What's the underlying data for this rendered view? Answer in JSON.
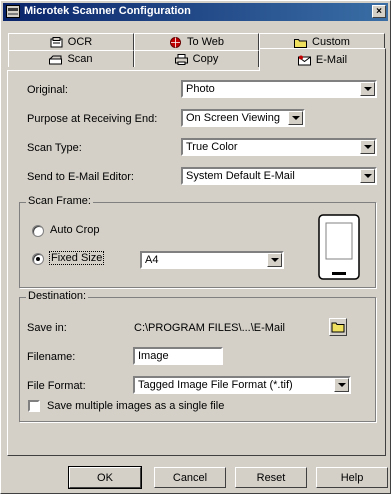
{
  "window": {
    "title": "Microtek Scanner Configuration",
    "close_glyph": "×"
  },
  "tabs": {
    "ocr": {
      "label": "OCR",
      "icon": "ocr-icon"
    },
    "to_web": {
      "label": "To Web",
      "icon": "web-globe-icon"
    },
    "custom": {
      "label": "Custom",
      "icon": "folder-icon"
    },
    "scan": {
      "label": "Scan",
      "icon": "scanner-icon"
    },
    "copy": {
      "label": "Copy",
      "icon": "printer-icon"
    },
    "email": {
      "label": "E-Mail",
      "icon": "email-icon",
      "active": true
    }
  },
  "form": {
    "original": {
      "label": "Original:",
      "value": "Photo"
    },
    "purpose": {
      "label": "Purpose at Receiving End:",
      "value": "On Screen Viewing"
    },
    "scan_type": {
      "label": "Scan Type:",
      "value": "True Color"
    },
    "send_to": {
      "label": "Send to E-Mail Editor:",
      "value": "System Default E-Mail"
    }
  },
  "scan_frame": {
    "title": "Scan Frame:",
    "auto_crop": {
      "label": "Auto Crop",
      "selected": false
    },
    "fixed_size": {
      "label": "Fixed Size",
      "selected": true
    },
    "size_value": "A4"
  },
  "destination": {
    "title": "Destination:",
    "save_in": {
      "label": "Save in:",
      "value": "C:\\PROGRAM FILES\\...\\E-Mail"
    },
    "filename": {
      "label": "Filename:",
      "value": "Image"
    },
    "file_format": {
      "label": "File Format:",
      "value": "Tagged Image File Format (*.tif)"
    },
    "multi": {
      "label": "Save multiple images as a single file",
      "checked": false
    }
  },
  "buttons": {
    "ok": "OK",
    "cancel": "Cancel",
    "reset": "Reset",
    "help": "Help"
  },
  "colors": {
    "titlebar_start": "#0a246a",
    "titlebar_end": "#3a6ea5",
    "face": "#d4d0c8"
  }
}
